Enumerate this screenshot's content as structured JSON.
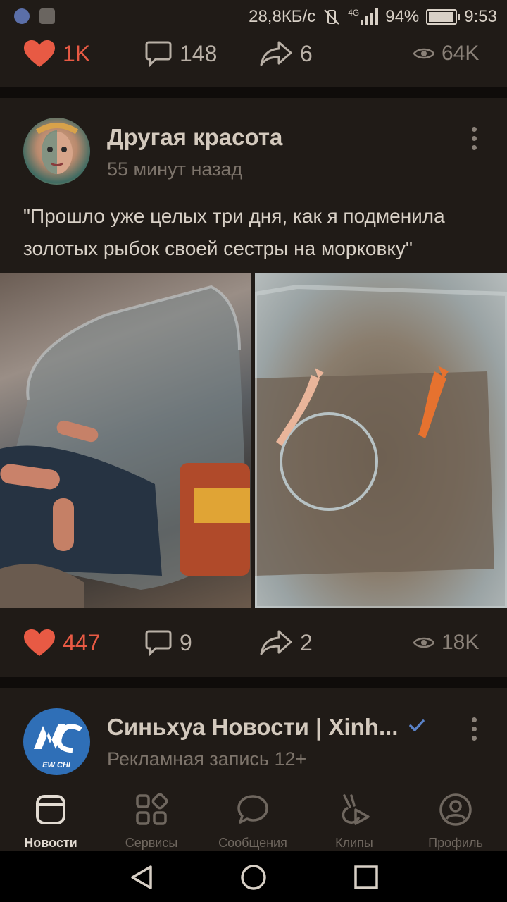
{
  "status_bar": {
    "network_speed": "28,8КБ/с",
    "network_type": "4G",
    "battery": "94%",
    "battery_level": 0.94,
    "time": "9:53"
  },
  "top_post": {
    "likes": "1K",
    "comments": "148",
    "shares": "6",
    "views": "64K"
  },
  "main_post": {
    "author": "Другая красота",
    "time": "55 минут назад",
    "text": "\"Прошло уже целых три дня, как я подменила золотых рыбок своей сестры на морковку\"",
    "likes": "447",
    "comments": "9",
    "shares": "2",
    "views": "18K"
  },
  "next_post": {
    "author": "Синьхуа Новости | Xinh...",
    "subtitle": "Рекламная запись 12+",
    "avatar_text": "EW CHI"
  },
  "bottom_nav": [
    {
      "label": "Новости",
      "icon": "news-icon"
    },
    {
      "label": "Сервисы",
      "icon": "services-icon"
    },
    {
      "label": "Сообщения",
      "icon": "messages-icon"
    },
    {
      "label": "Клипы",
      "icon": "clips-icon"
    },
    {
      "label": "Профиль",
      "icon": "profile-icon"
    }
  ],
  "colors": {
    "like": "#e85a44",
    "verified": "#5a82c8",
    "background": "#201b17"
  }
}
